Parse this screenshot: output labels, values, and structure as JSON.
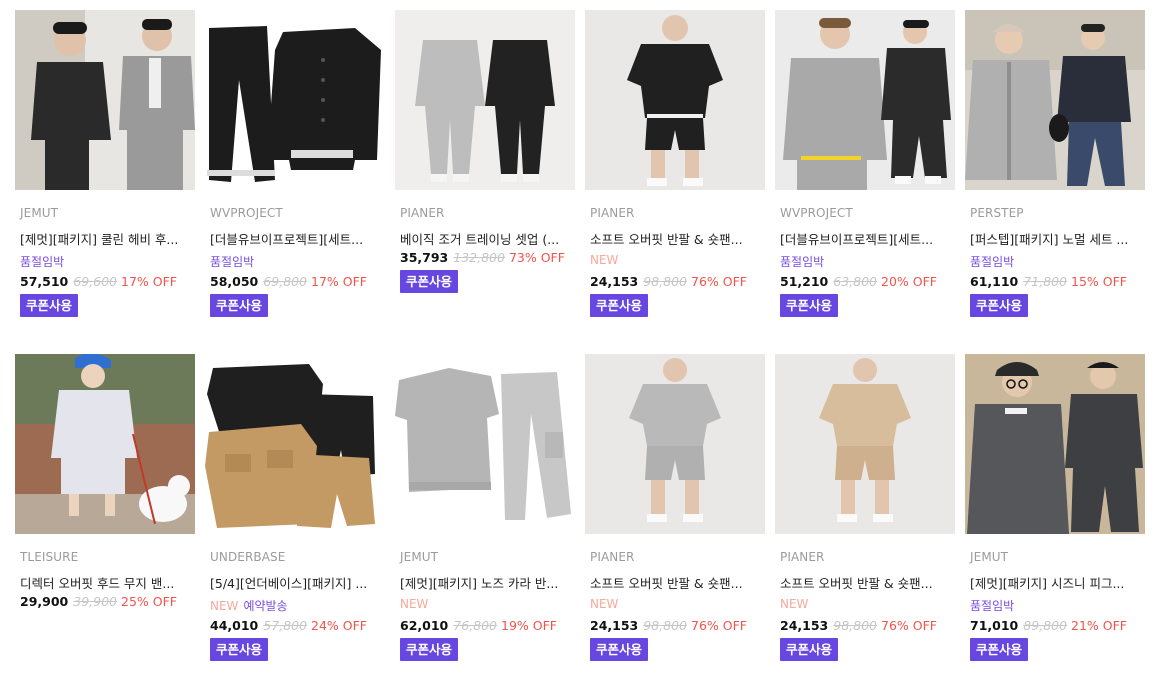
{
  "products": [
    {
      "brand": "JEMUT",
      "name": "[제멋][패키지] 쿨린 헤비 후...",
      "status": "품절임박",
      "new": "",
      "badge": "",
      "price": "57,510",
      "original": "69,600",
      "discount": "17% OFF",
      "coupon": "쿠폰사용",
      "colors": {
        "bg": "#e8e6e2",
        "main": "#2a2a2a",
        "accent": "#9a9a9a"
      }
    },
    {
      "brand": "WVPROJECT",
      "name": "[더블유브이프로젝트][세트...",
      "status": "품절임박",
      "new": "",
      "badge": "",
      "price": "58,050",
      "original": "69,800",
      "discount": "17% OFF",
      "coupon": "쿠폰사용",
      "colors": {
        "bg": "#ffffff",
        "main": "#1c1c1c",
        "accent": "#1c1c1c"
      }
    },
    {
      "brand": "PIANER",
      "name": "베이직 조거 트레이닝 셋업 (...",
      "status": "",
      "new": "",
      "badge": "",
      "price": "35,793",
      "original": "132,800",
      "discount": "73% OFF",
      "coupon": "쿠폰사용",
      "colors": {
        "bg": "#efeeec",
        "main": "#bdbdbd",
        "accent": "#222222"
      }
    },
    {
      "brand": "PIANER",
      "name": "소프트 오버핏 반팔 & 숏팬...",
      "status": "",
      "new": "NEW",
      "badge": "",
      "price": "24,153",
      "original": "98,800",
      "discount": "76% OFF",
      "coupon": "쿠폰사용",
      "colors": {
        "bg": "#e9e8e6",
        "main": "#202020",
        "accent": "#202020"
      }
    },
    {
      "brand": "WVPROJECT",
      "name": "[더블유브이프로젝트][세트...",
      "status": "품절임박",
      "new": "",
      "badge": "",
      "price": "51,210",
      "original": "63,800",
      "discount": "20% OFF",
      "coupon": "쿠폰사용",
      "colors": {
        "bg": "#ebebeb",
        "main": "#a9a9a9",
        "accent": "#2b2b2b"
      }
    },
    {
      "brand": "PERSTEP",
      "name": "[퍼스텝][패키지] 노멀 세트 ...",
      "status": "품절임박",
      "new": "",
      "badge": "",
      "price": "61,110",
      "original": "71,800",
      "discount": "15% OFF",
      "coupon": "쿠폰사용",
      "colors": {
        "bg": "#d9d4cc",
        "main": "#b0b0b0",
        "accent": "#2a2e3a"
      }
    },
    {
      "brand": "TLEISURE",
      "name": "디렉터 오버핏 후드 무지 밴...",
      "status": "",
      "new": "",
      "badge": "",
      "price": "29,900",
      "original": "39,900",
      "discount": "25% OFF",
      "coupon": "",
      "colors": {
        "bg": "#9c6b52",
        "main": "#e4e4ec",
        "accent": "#2f6fd1"
      }
    },
    {
      "brand": "UNDERBASE",
      "name": "[5/4][언더베이스][패키지] ...",
      "status": "",
      "new": "NEW",
      "badge": "예약발송",
      "price": "44,010",
      "original": "57,800",
      "discount": "24% OFF",
      "coupon": "쿠폰사용",
      "colors": {
        "bg": "#ffffff",
        "main": "#c49a64",
        "accent": "#1f1f1f"
      }
    },
    {
      "brand": "JEMUT",
      "name": "[제멋][패키지] 노즈 카라 반...",
      "status": "",
      "new": "NEW",
      "badge": "",
      "price": "62,010",
      "original": "76,800",
      "discount": "19% OFF",
      "coupon": "쿠폰사용",
      "colors": {
        "bg": "#ffffff",
        "main": "#b5b5b5",
        "accent": "#c7c7c7"
      }
    },
    {
      "brand": "PIANER",
      "name": "소프트 오버핏 반팔 & 숏팬...",
      "status": "",
      "new": "NEW",
      "badge": "",
      "price": "24,153",
      "original": "98,800",
      "discount": "76% OFF",
      "coupon": "쿠폰사용",
      "colors": {
        "bg": "#e9e8e6",
        "main": "#b9b9b9",
        "accent": "#b0b0b0"
      }
    },
    {
      "brand": "PIANER",
      "name": "소프트 오버핏 반팔 & 숏팬...",
      "status": "",
      "new": "NEW",
      "badge": "",
      "price": "24,153",
      "original": "98,800",
      "discount": "76% OFF",
      "coupon": "쿠폰사용",
      "colors": {
        "bg": "#e9e8e6",
        "main": "#d8bd9c",
        "accent": "#cfb08e"
      }
    },
    {
      "brand": "JEMUT",
      "name": "[제멋][패키지] 시즈니 피그...",
      "status": "품절임박",
      "new": "",
      "badge": "",
      "price": "71,010",
      "original": "89,800",
      "discount": "21% OFF",
      "coupon": "쿠폰사용",
      "colors": {
        "bg": "#c9b79c",
        "main": "#55575a",
        "accent": "#3d3f42"
      }
    }
  ]
}
